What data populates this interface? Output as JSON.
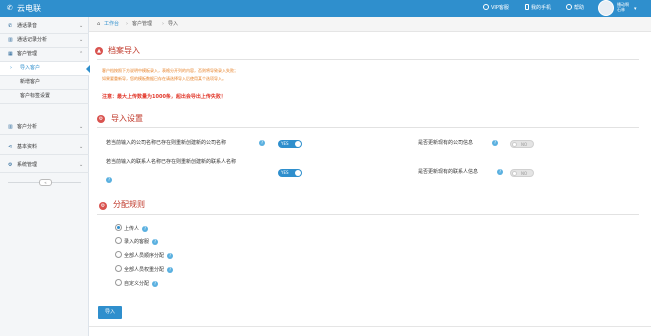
{
  "brand": {
    "icon": "phone-icon",
    "name": "云电联"
  },
  "topnav": {
    "voip": "VIP客服",
    "mobile": "我的手机",
    "help": "帮助",
    "user_line1": "播动啊",
    "user_line2": "石林"
  },
  "sidebar": {
    "items": [
      {
        "icon": "phone-icon",
        "label": "通话录音"
      },
      {
        "icon": "chart-icon",
        "label": "通话记录分析"
      },
      {
        "icon": "people-icon",
        "label": "客户管理"
      },
      {
        "label": "导入客户",
        "active": true
      },
      {
        "label": "新增客户"
      },
      {
        "label": "客户标签设置"
      },
      {
        "icon": "chart-icon",
        "label": "客户分析"
      },
      {
        "icon": "share-icon",
        "label": "基本资料"
      },
      {
        "icon": "gears-icon",
        "label": "系统管理"
      }
    ],
    "collapse_icon": "double-chevron-left-icon"
  },
  "breadcrumb": {
    "home": "工作台",
    "section": "客户管理",
    "current": "导入",
    "separator": "›"
  },
  "section_import": {
    "title": "档案导入",
    "note_line1": "客户档按照下方说明中模板录入，表格分开列的内容，否则将导致录入失败；",
    "note_line2": "如果要重新导，您的模板数据已存在请选择导入后使用某个选项导入。",
    "warning": "注意：最大上传数量为1000条，超出会导出上传失败！"
  },
  "section_settings": {
    "title": "导入设置",
    "q1": "若当前输入的公司名称已存在则重新创建新的公司名称",
    "q1_value": "YES",
    "q2": "是否更新现有的公司信息",
    "q2_value": "NO",
    "q3": "若当前输入的联系人名称已存在则重新创建新的联系人名称",
    "q3_value": "YES",
    "q4": "是否更新现有的联系人信息",
    "q4_value": "NO"
  },
  "section_assign": {
    "title": "分配规则",
    "options": [
      {
        "label": "上传人",
        "checked": true
      },
      {
        "label": "录入的客服",
        "checked": false
      },
      {
        "label": "全部人员顺序分配",
        "checked": false
      },
      {
        "label": "全部人员权重分配",
        "checked": false
      },
      {
        "label": "自定义分配",
        "checked": false
      }
    ]
  },
  "actions": {
    "import_label": "导入"
  },
  "colors": {
    "primary": "#2f8fcd",
    "section_title": "#c0392b",
    "warning": "#e23b2e",
    "note": "#e67e22"
  }
}
